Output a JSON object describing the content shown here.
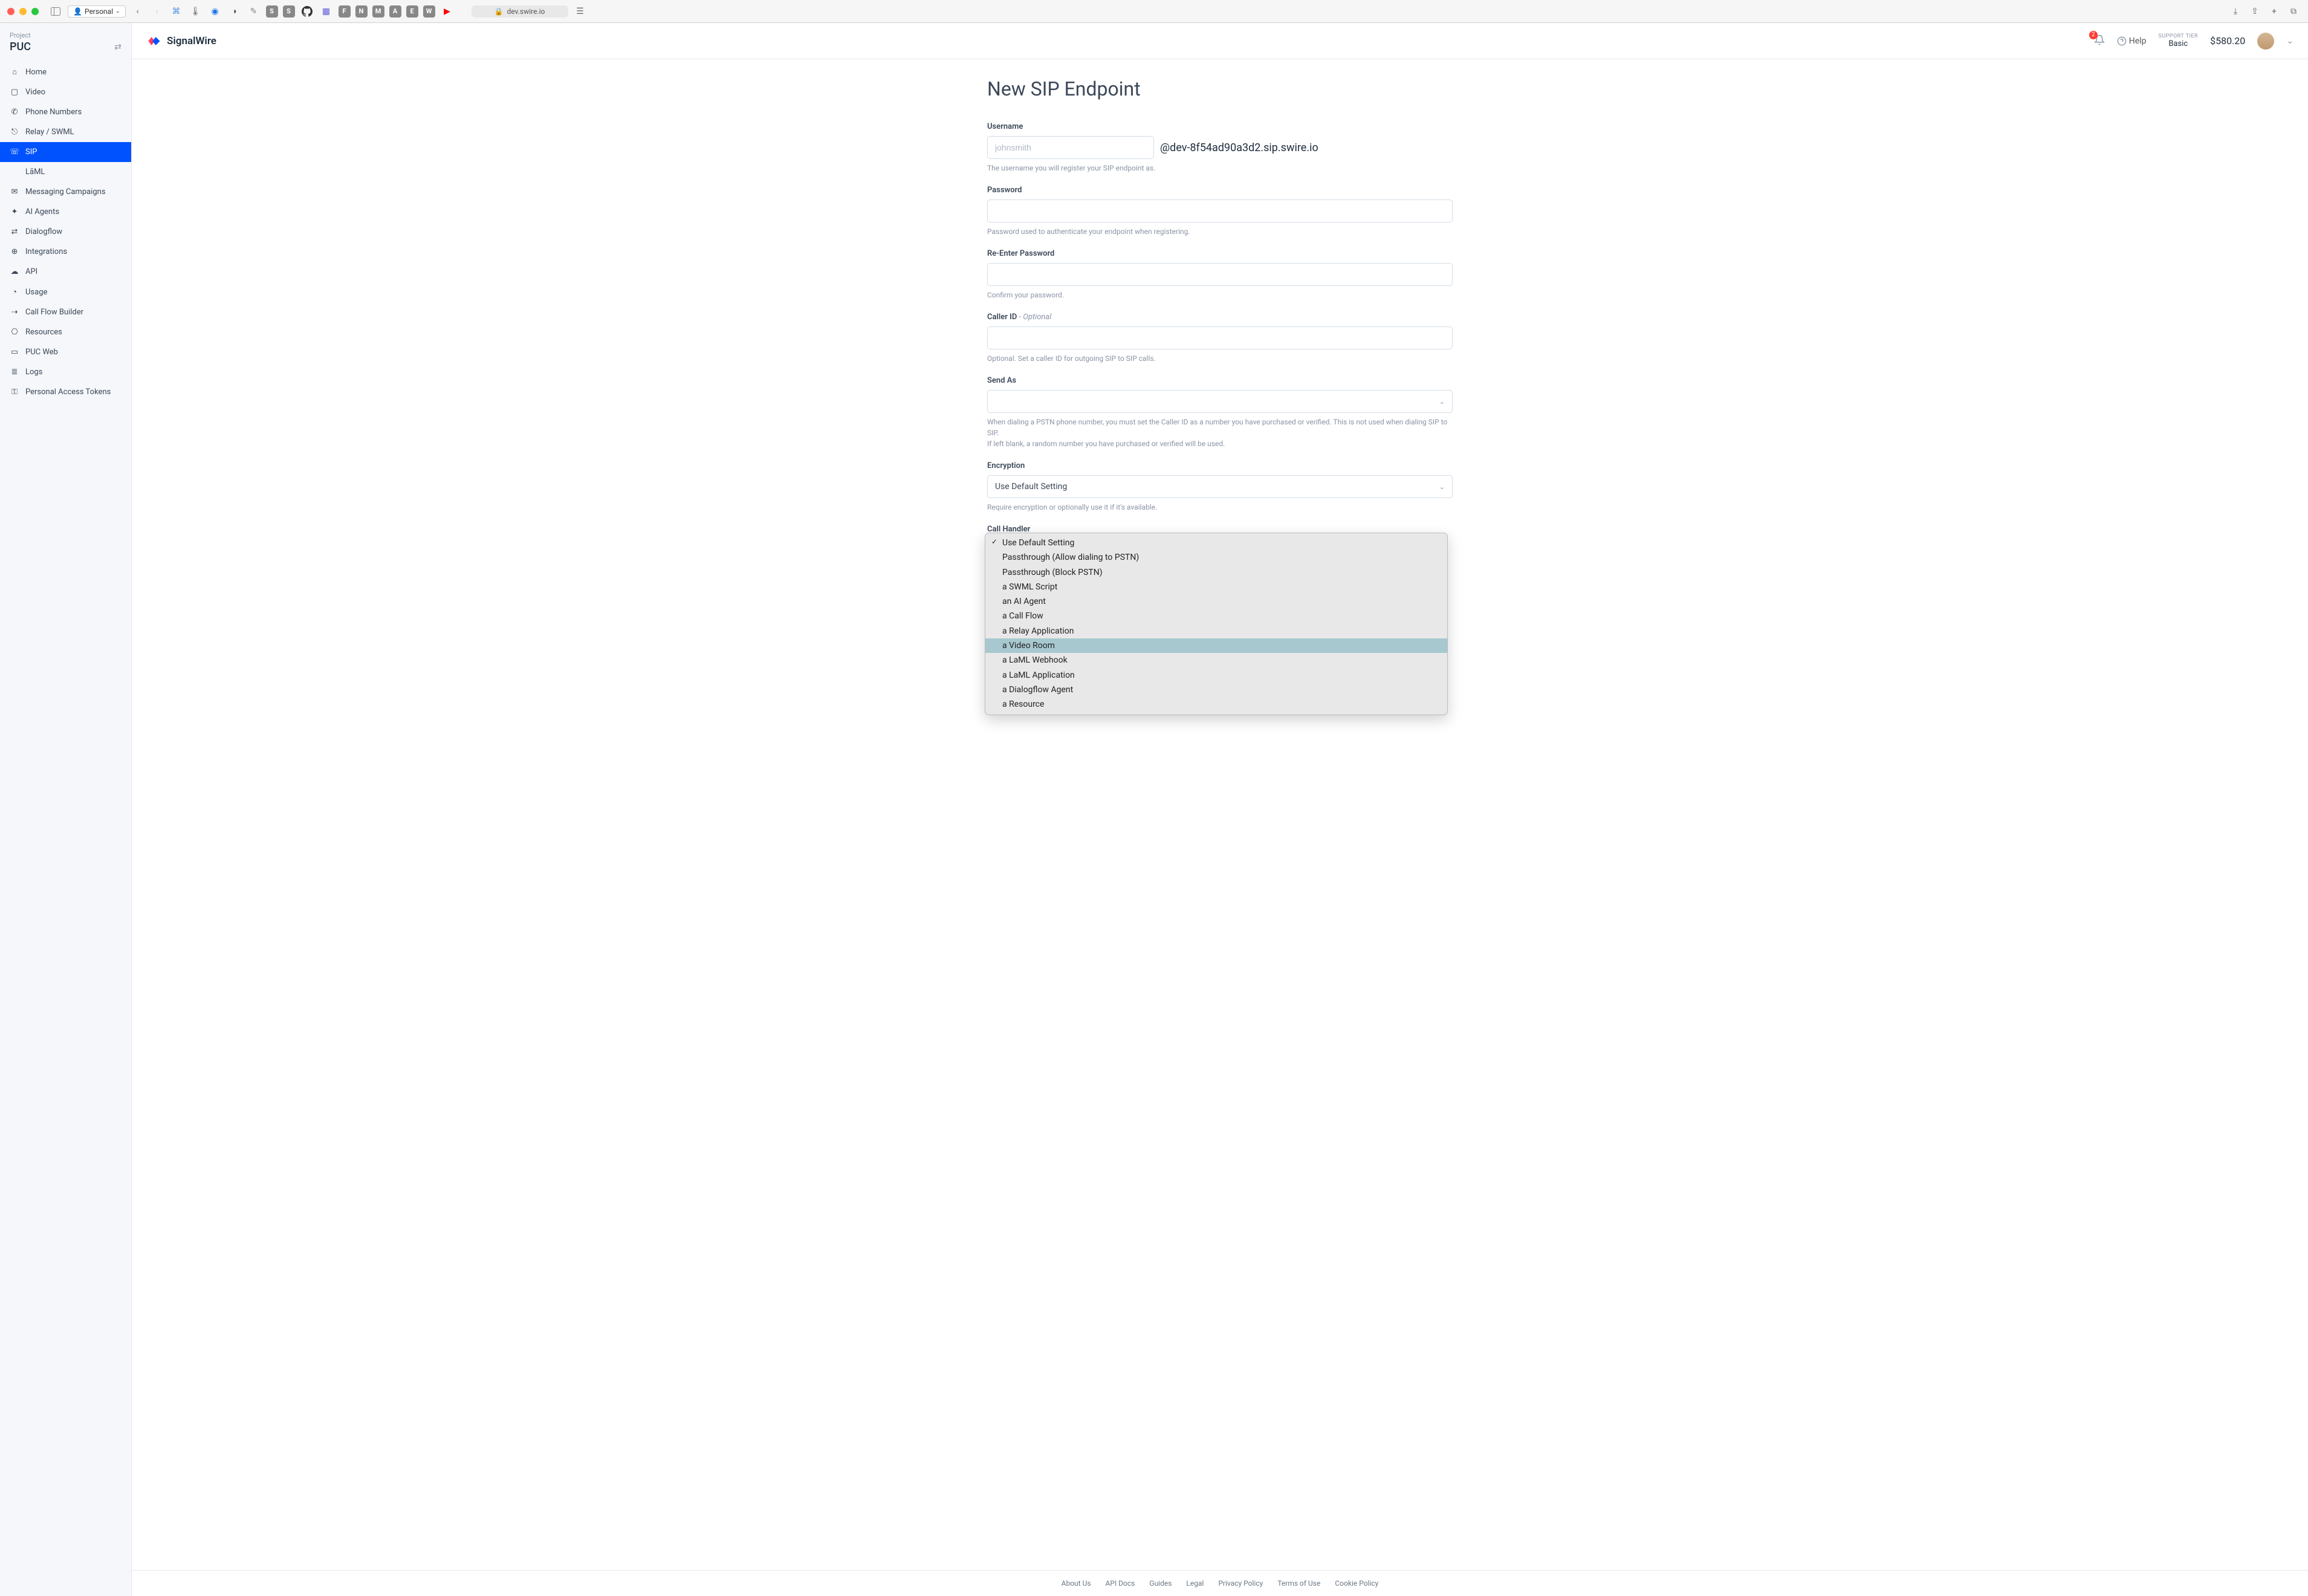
{
  "browser": {
    "profile": "Personal",
    "url_display": "dev.swire.io",
    "tab_letters": [
      "S",
      "S",
      "F",
      "N",
      "M",
      "A",
      "E",
      "W"
    ]
  },
  "sidebar": {
    "project_label": "Project",
    "project_name": "PUC",
    "items": [
      {
        "icon": "⌂",
        "label": "Home"
      },
      {
        "icon": "▢",
        "label": "Video"
      },
      {
        "icon": "✆",
        "label": "Phone Numbers"
      },
      {
        "icon": "⎋",
        "label": "Relay / SWML"
      },
      {
        "icon": "☏",
        "label": "SIP"
      },
      {
        "icon": "</>",
        "label": "LāML"
      },
      {
        "icon": "✉",
        "label": "Messaging Campaigns"
      },
      {
        "icon": "✦",
        "label": "AI Agents"
      },
      {
        "icon": "⇄",
        "label": "Dialogflow"
      },
      {
        "icon": "⊕",
        "label": "Integrations"
      },
      {
        "icon": "☁",
        "label": "API"
      },
      {
        "icon": "◔",
        "label": "Usage"
      },
      {
        "icon": "⇢",
        "label": "Call Flow Builder"
      },
      {
        "icon": "⎔",
        "label": "Resources"
      },
      {
        "icon": "▭",
        "label": "PUC Web"
      },
      {
        "icon": "≣",
        "label": "Logs"
      },
      {
        "icon": "⚿",
        "label": "Personal Access Tokens"
      }
    ],
    "active_index": 4
  },
  "topbar": {
    "brand": "SignalWire",
    "notif_count": "2",
    "help_label": "Help",
    "tier_label": "SUPPORT TIER",
    "tier_value": "Basic",
    "balance": "$580.20"
  },
  "page": {
    "title": "New SIP Endpoint",
    "username": {
      "label": "Username",
      "placeholder": "johnsmith",
      "suffix": "@dev-8f54ad90a3d2.sip.swire.io",
      "help": "The username you will register your SIP endpoint as."
    },
    "password": {
      "label": "Password",
      "help": "Password used to authenticate your endpoint when registering."
    },
    "password2": {
      "label": "Re-Enter Password",
      "help": "Confirm your password."
    },
    "caller_id": {
      "label": "Caller ID",
      "optional": "- Optional",
      "help": "Optional. Set a caller ID for outgoing SIP to SIP calls."
    },
    "send_as": {
      "label": "Send As",
      "help": "When dialing a PSTN phone number, you must set the Caller ID as a number you have purchased or verified. This is not used when dialing SIP to SIP.",
      "help2": "If left blank, a random number you have purchased or verified will be used."
    },
    "encryption": {
      "label": "Encryption",
      "value": "Use Default Setting",
      "help": "Require encryption or optionally use it if it's available."
    },
    "call_handler": {
      "label": "Call Handler",
      "options": [
        "Use Default Setting",
        "Passthrough (Allow dialing to PSTN)",
        "Passthrough (Block PSTN)",
        "a SWML Script",
        "an AI Agent",
        "a Call Flow",
        "a Relay Application",
        "a Video Room",
        "a LaML Webhook",
        "a LaML Application",
        "a Dialogflow Agent",
        "a Resource"
      ],
      "selected_index": 0,
      "highlighted_index": 7
    }
  },
  "footer": {
    "links": [
      "About Us",
      "API Docs",
      "Guides",
      "Legal",
      "Privacy Policy",
      "Terms of Use",
      "Cookie Policy"
    ]
  }
}
